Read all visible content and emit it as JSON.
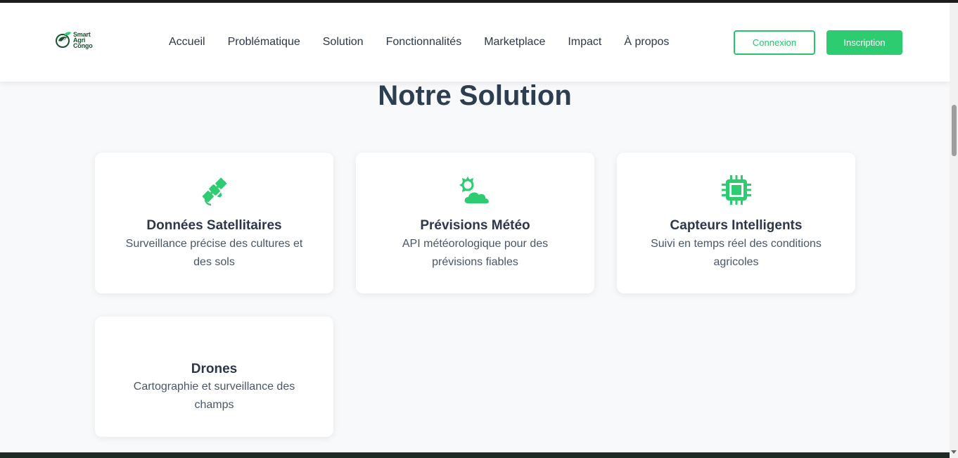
{
  "brand": {
    "line1": "Smart",
    "line2": "Agri",
    "line3": "Congo",
    "color": "#14532d"
  },
  "nav": [
    {
      "label": "Accueil"
    },
    {
      "label": "Problématique"
    },
    {
      "label": "Solution"
    },
    {
      "label": "Fonctionnalités"
    },
    {
      "label": "Marketplace"
    },
    {
      "label": "Impact"
    },
    {
      "label": "À propos"
    }
  ],
  "auth": {
    "login_label": "Connexion",
    "signup_label": "Inscription"
  },
  "section": {
    "title": "Notre Solution"
  },
  "cards": [
    {
      "icon": "satellite-icon",
      "title": "Données Satellitaires",
      "desc": "Surveillance précise des cultures et des sols"
    },
    {
      "icon": "sun-cloud-icon",
      "title": "Prévisions Météo",
      "desc": "API météorologique pour des prévisions fiables"
    },
    {
      "icon": "microchip-icon",
      "title": "Capteurs Intelligents",
      "desc": "Suivi en temps réel des conditions agricoles"
    },
    {
      "icon": "",
      "title": "Drones",
      "desc": "Cartographie et surveillance des champs"
    }
  ],
  "colors": {
    "accent": "#2ecc71",
    "title": "#2c3e50",
    "text": "#4a5568"
  }
}
